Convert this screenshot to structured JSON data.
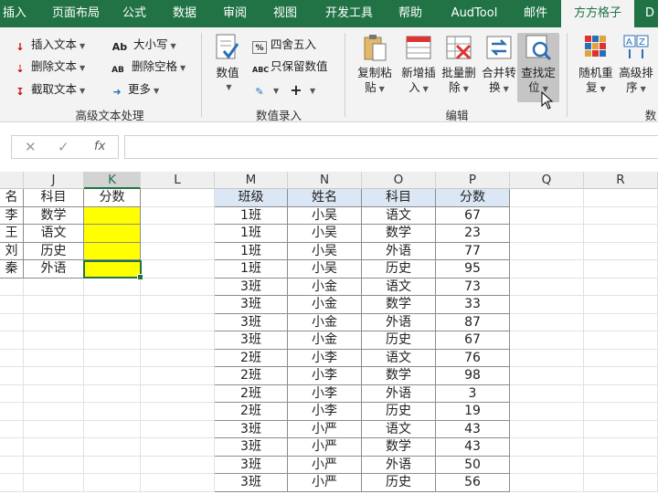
{
  "ribbon_tabs": [
    {
      "label": "插入",
      "active": false
    },
    {
      "label": "页面布局",
      "active": false
    },
    {
      "label": "公式",
      "active": false
    },
    {
      "label": "数据",
      "active": false
    },
    {
      "label": "审阅",
      "active": false
    },
    {
      "label": "视图",
      "active": false
    },
    {
      "label": "开发工具",
      "active": false
    },
    {
      "label": "帮助",
      "active": false
    },
    {
      "label": "AudTool",
      "active": false
    },
    {
      "label": "邮件",
      "active": false
    },
    {
      "label": "方方格子",
      "active": true
    },
    {
      "label": "D",
      "active": false
    }
  ],
  "ribbon": {
    "text_group": {
      "label": "高级文本处理",
      "insert_text": "插入文本",
      "delete_text": "删除文本",
      "cut_text": "截取文本",
      "case": "大小写",
      "delete_spaces": "删除空格",
      "more": "更多",
      "case_icon": "Ab",
      "delete_spaces_icon": "AB"
    },
    "number_group": {
      "label": "数值录入",
      "value_button": "数值",
      "round": "四舍五入",
      "keep_numbers": "只保留数值",
      "keep_numbers_icon": "ABC",
      "round_icon": "%"
    },
    "edit_group": {
      "label": "编辑",
      "copy_paste": [
        "复制粘",
        "贴"
      ],
      "add_insert": [
        "新增插",
        "入"
      ],
      "batch_delete": [
        "批量删",
        "除"
      ],
      "merge_convert": [
        "合并转",
        "换"
      ],
      "find_locate": [
        "查找定",
        "位"
      ]
    },
    "next_group": {
      "random": [
        "随机重",
        "复"
      ],
      "advanced_sort": [
        "高级排",
        "序"
      ],
      "label_partial": "数"
    }
  },
  "formula_bar": {
    "cancel": "✕",
    "confirm": "✓",
    "fx": "fx",
    "value": ""
  },
  "columns": [
    "",
    "J",
    "K",
    "L",
    "M",
    "N",
    "O",
    "P",
    "Q",
    "R"
  ],
  "left_table": {
    "headers": [
      "名",
      "科目",
      "分数"
    ],
    "rows": [
      [
        "李",
        "数学",
        ""
      ],
      [
        "王",
        "语文",
        ""
      ],
      [
        "刘",
        "历史",
        ""
      ],
      [
        "秦",
        "外语",
        ""
      ]
    ]
  },
  "right_table": {
    "headers": [
      "班级",
      "姓名",
      "科目",
      "分数"
    ],
    "rows": [
      [
        "1班",
        "小吴",
        "语文",
        "67"
      ],
      [
        "1班",
        "小吴",
        "数学",
        "23"
      ],
      [
        "1班",
        "小吴",
        "外语",
        "77"
      ],
      [
        "1班",
        "小吴",
        "历史",
        "95"
      ],
      [
        "3班",
        "小金",
        "语文",
        "73"
      ],
      [
        "3班",
        "小金",
        "数学",
        "33"
      ],
      [
        "3班",
        "小金",
        "外语",
        "87"
      ],
      [
        "3班",
        "小金",
        "历史",
        "67"
      ],
      [
        "2班",
        "小李",
        "语文",
        "76"
      ],
      [
        "2班",
        "小李",
        "数学",
        "98"
      ],
      [
        "2班",
        "小李",
        "外语",
        "3"
      ],
      [
        "2班",
        "小李",
        "历史",
        "19"
      ],
      [
        "3班",
        "小严",
        "语文",
        "43"
      ],
      [
        "3班",
        "小严",
        "数学",
        "43"
      ],
      [
        "3班",
        "小严",
        "外语",
        "50"
      ],
      [
        "3班",
        "小严",
        "历史",
        "56"
      ],
      [
        "",
        "",
        "",
        ""
      ]
    ]
  },
  "colors": {
    "excel_green": "#217346",
    "highlight_yellow": "#ffff00",
    "header_fill": "#dbe7f5"
  }
}
